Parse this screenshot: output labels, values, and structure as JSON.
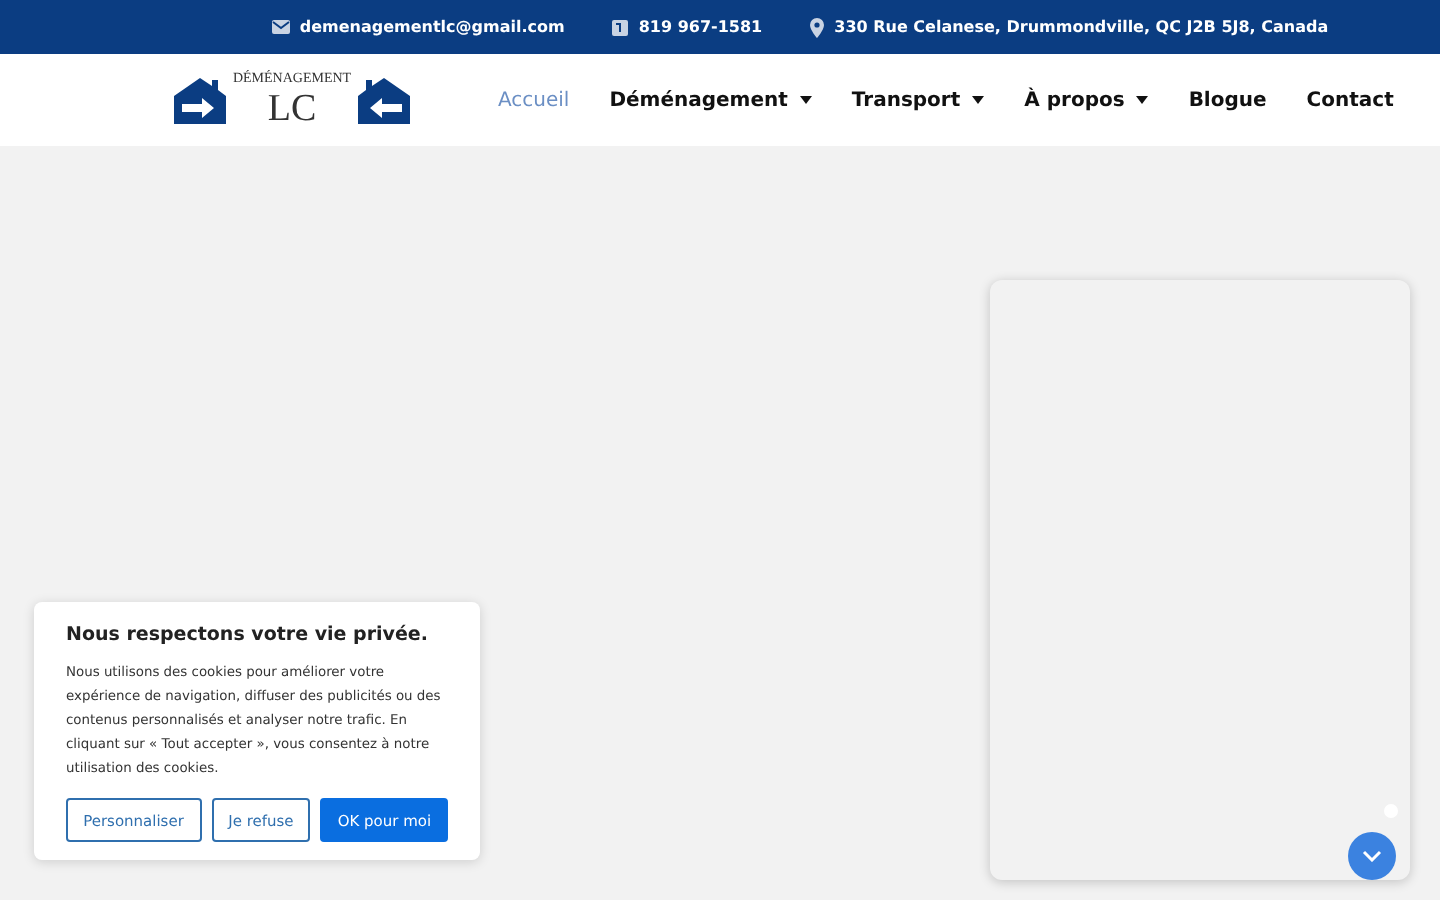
{
  "top_bar": [
    {
      "kind": "email",
      "text": "demenagementlc@gmail.com"
    },
    {
      "kind": "phone",
      "text": "819 967-1581"
    },
    {
      "kind": "pin",
      "text": "330 Rue Celanese, Drummondville, QC J2B 5J8, Canada"
    }
  ],
  "logo": {
    "top": "DÉMÉNAGEMENT",
    "main": "LC"
  },
  "nav": [
    {
      "label": "Accueil",
      "selected": true,
      "dropdown": false
    },
    {
      "label": "Déménagement",
      "selected": false,
      "dropdown": true
    },
    {
      "label": "Transport",
      "selected": false,
      "dropdown": true
    },
    {
      "label": "À propos",
      "selected": false,
      "dropdown": true
    },
    {
      "label": "Blogue",
      "selected": false,
      "dropdown": false
    },
    {
      "label": "Contact",
      "selected": false,
      "dropdown": false
    }
  ],
  "cookie_banner": {
    "title": "Nous respectons votre vie privée.",
    "body": "Nous utilisons des cookies pour améliorer votre expérience de navigation, diffuser des publicités ou des contenus personnalisés et analyser notre trafic. En cliquant sur « Tout accepter », vous consentez à notre utilisation des cookies.",
    "buttons": [
      {
        "label": "Personnaliser",
        "kind": "outline"
      },
      {
        "label": "Je refuse",
        "kind": "outline"
      },
      {
        "label": "OK pour moi",
        "kind": "primary"
      }
    ]
  }
}
